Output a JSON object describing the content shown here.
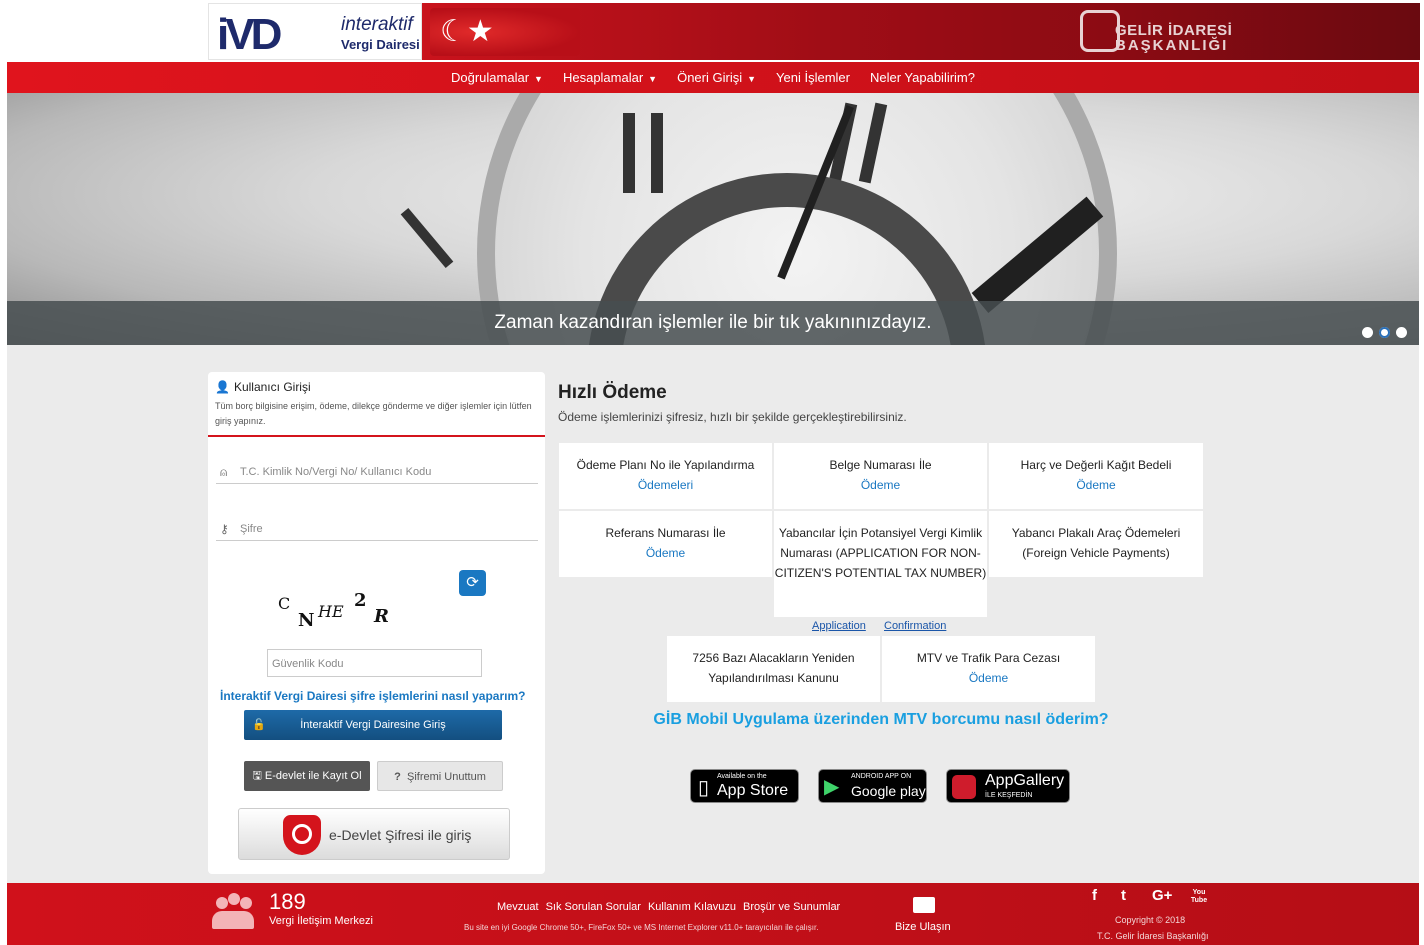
{
  "header": {
    "brand_mark": "iVD",
    "brand_line1": "interaktif",
    "brand_line2": "Vergi Dairesi",
    "agency_line1": "GELİR İDARESİ",
    "agency_line2": "BAŞKANLIĞI"
  },
  "nav": {
    "items": [
      {
        "label": "Doğrulamalar",
        "has_dropdown": true
      },
      {
        "label": "Hesaplamalar",
        "has_dropdown": true
      },
      {
        "label": "Öneri Girişi",
        "has_dropdown": true
      },
      {
        "label": "Yeni İşlemler",
        "has_dropdown": false
      },
      {
        "label": "Neler Yapabilirim?",
        "has_dropdown": false
      }
    ],
    "caret": "▼"
  },
  "hero": {
    "caption": "Zaman kazandıran işlemler ile bir tık yakınınızdayız.",
    "slide_count": 3,
    "active_slide": 2
  },
  "login": {
    "title": "Kullanıcı Girişi",
    "title_icon": "user-icon",
    "description": "Tüm borç bilgisine erişim, ödeme, dilekçe gönderme ve diğer işlemler için lütfen giriş yapınız.",
    "username_placeholder": "T.C. Kimlik No/Vergi No/ Kullanıcı Kodu",
    "password_placeholder": "Şifre",
    "captcha_chars": [
      "C",
      "N",
      "HE",
      "2",
      "R"
    ],
    "security_placeholder": "Güvenlik Kodu",
    "help_link": "İnteraktif Vergi Dairesi şifre işlemlerini nasıl yaparım?",
    "login_button": "İnteraktif Vergi Dairesine Giriş",
    "register_button": "E-devlet ile Kayıt Ol",
    "forgot_button": "Şifremi Unuttum",
    "forgot_prefix": "?",
    "edevlet_button": "e-Devlet Şifresi ile giriş"
  },
  "quick_payment": {
    "title": "Hızlı Ödeme",
    "description": "Ödeme işlemlerinizi şifresiz, hızlı bir şekilde gerçekleştirebilirsiniz.",
    "tiles": [
      {
        "text": "Ödeme Planı No ile Yapılandırma",
        "link": "Ödemeleri"
      },
      {
        "text": "Belge Numarası İle",
        "link": "Ödeme"
      },
      {
        "text": "Harç ve Değerli Kağıt Bedeli",
        "link": "Ödeme"
      },
      {
        "text": "Referans Numarası İle",
        "link": "Ödeme"
      },
      {
        "text": "Yabancılar İçin Potansiyel Vergi Kimlik Numarası (APPLICATION FOR NON-CITIZEN'S POTENTIAL TAX NUMBER)",
        "link": ""
      },
      {
        "text": "Yabancı Plakalı Araç Ödemeleri (Foreign Vehicle Payments)",
        "link": ""
      },
      {
        "text": "7256 Bazı Alacakların Yeniden Yapılandırılması Kanunu",
        "link": ""
      },
      {
        "text": "MTV ve Trafik Para Cezası",
        "link": "Ödeme"
      }
    ],
    "application_link": "Application",
    "confirmation_link": "Confirmation",
    "mobile_link": "GİB Mobil Uygulama üzerinden MTV borcumu nasıl öderim?"
  },
  "stores": [
    {
      "small": "Available on the",
      "big": "App Store"
    },
    {
      "small": "ANDROID APP ON",
      "big": "Google play"
    },
    {
      "small": "İLE KEŞFEDİN",
      "big": "AppGallery"
    }
  ],
  "footer": {
    "phone": "189",
    "phone_label": "Vergi İletişim Merkezi",
    "links": [
      "Mevzuat",
      "Sık Sorulan Sorular",
      "Kullanım Kılavuzu",
      "Broşür ve Sunumlar"
    ],
    "browser_note": "Bu site en iyi Google Chrome 50+, FireFox 50+ ve MS Internet Explorer v11.0+ tarayıcıları ile çalışır.",
    "contact": "Bize Ulaşın",
    "social": [
      "f",
      "t",
      "G+",
      "You Tube"
    ],
    "copyright1": "Copyright © 2018",
    "copyright2": "T.C. Gelir İdaresi Başkanlığı"
  }
}
